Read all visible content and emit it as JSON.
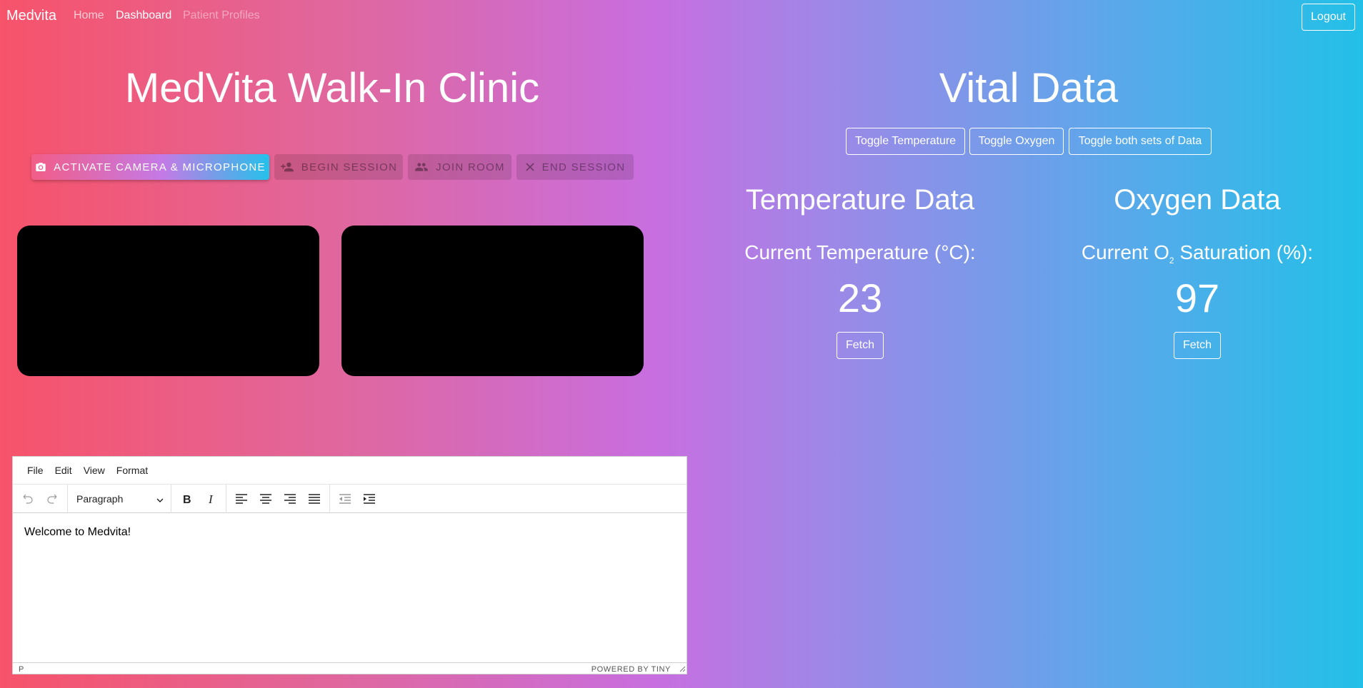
{
  "navbar": {
    "brand": "Medvita",
    "links": [
      "Home",
      "Dashboard",
      "Patient Profiles"
    ],
    "active": "Dashboard",
    "logout_label": "Logout"
  },
  "clinic": {
    "title": "MedVita Walk-In Clinic",
    "buttons": {
      "activate": {
        "label": "Activate Camera & Microphone",
        "icon": "camera-icon"
      },
      "begin": {
        "label": "Begin Session",
        "icon": "add-person-icon"
      },
      "join": {
        "label": "Join Room",
        "icon": "group-icon"
      },
      "end": {
        "label": "End Session",
        "icon": "close-icon"
      }
    }
  },
  "editor": {
    "menu": [
      "File",
      "Edit",
      "View",
      "Format"
    ],
    "block_format": "Paragraph",
    "content": "Welcome to Medvita!",
    "status_path": "P",
    "powered_by": "POWERED BY TINY"
  },
  "vitals": {
    "title": "Vital Data",
    "toggles": [
      "Toggle Temperature",
      "Toggle Oxygen",
      "Toggle both sets of Data"
    ],
    "temperature": {
      "heading": "Temperature Data",
      "label": "Current Temperature (°C):",
      "value": "23",
      "fetch_label": "Fetch"
    },
    "oxygen": {
      "heading": "Oxygen Data",
      "label_prefix": "Current O",
      "label_sub": "2",
      "label_suffix": " Saturation (%):",
      "value": "97",
      "fetch_label": "Fetch"
    }
  },
  "colors": {
    "gradient_left": "#f7536a",
    "gradient_mid": "#c86ee0",
    "gradient_right": "#22c0e8"
  }
}
